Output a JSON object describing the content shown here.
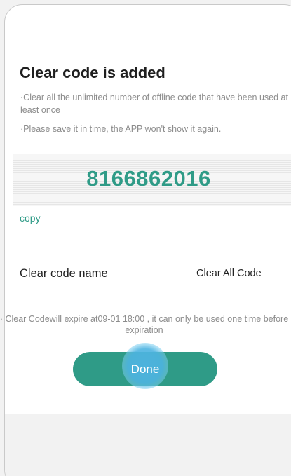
{
  "dialog": {
    "title": "Clear code is added",
    "notes": [
      "·Clear all the unlimited number of  offline code that have been used at least once",
      "·Please save it in time, the APP won't show it again."
    ],
    "code": "8166862016",
    "copy_label": "copy",
    "name_label": "Clear code name",
    "name_value": "Clear All Code",
    "expire_note": "· Clear Codewill expire at09-01 18:00 , it can only be used one time before expiration",
    "done_label": "Done"
  },
  "colors": {
    "accent": "#2f9b87",
    "tap_indicator": "#4eb4e1",
    "muted_text": "#8c8c8c"
  }
}
